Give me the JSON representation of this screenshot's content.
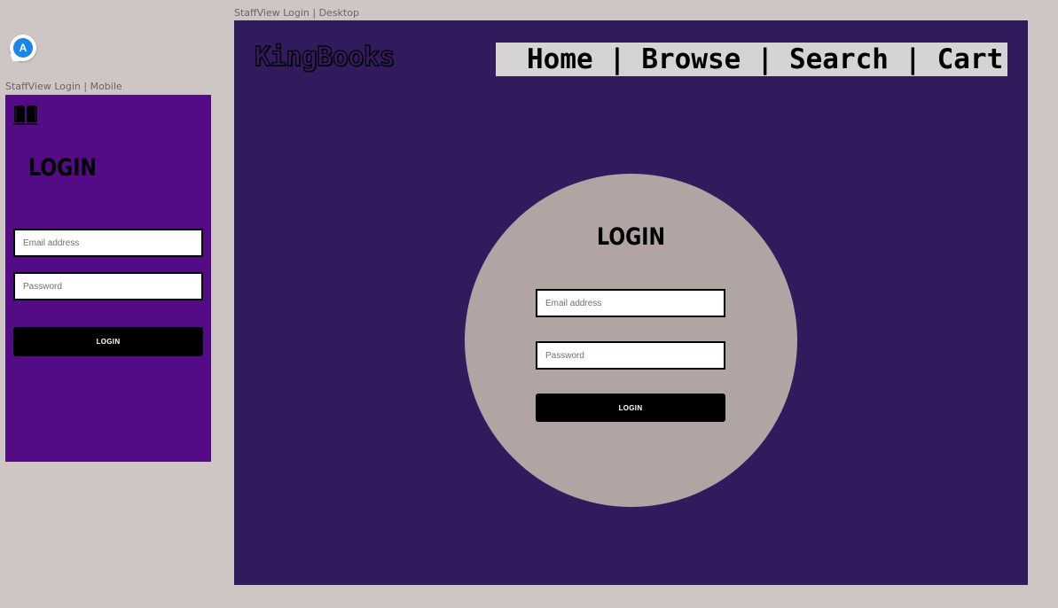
{
  "canvas": {
    "background": "#cec6c4"
  },
  "avatar": {
    "initial": "A",
    "color": "#1a86e8"
  },
  "mobile": {
    "caption": "StaffView Login | Mobile",
    "background": "#530b86",
    "icon": "book-icon",
    "title": "LOGIN",
    "email_placeholder": "Email address",
    "password_placeholder": "Password",
    "login_button": "LOGIN"
  },
  "desktop": {
    "caption": "StaffView Login | Desktop",
    "background": "#311b5c",
    "brand": "KingBooks",
    "nav": {
      "items": [
        "Home",
        "Browse",
        "Search",
        "Cart"
      ],
      "separator": "|",
      "background": "#d5d3d3"
    },
    "circle_color": "#b0a5a3",
    "title": "LOGIN",
    "email_placeholder": "Email address",
    "password_placeholder": "Password",
    "login_button": "LOGIN"
  }
}
